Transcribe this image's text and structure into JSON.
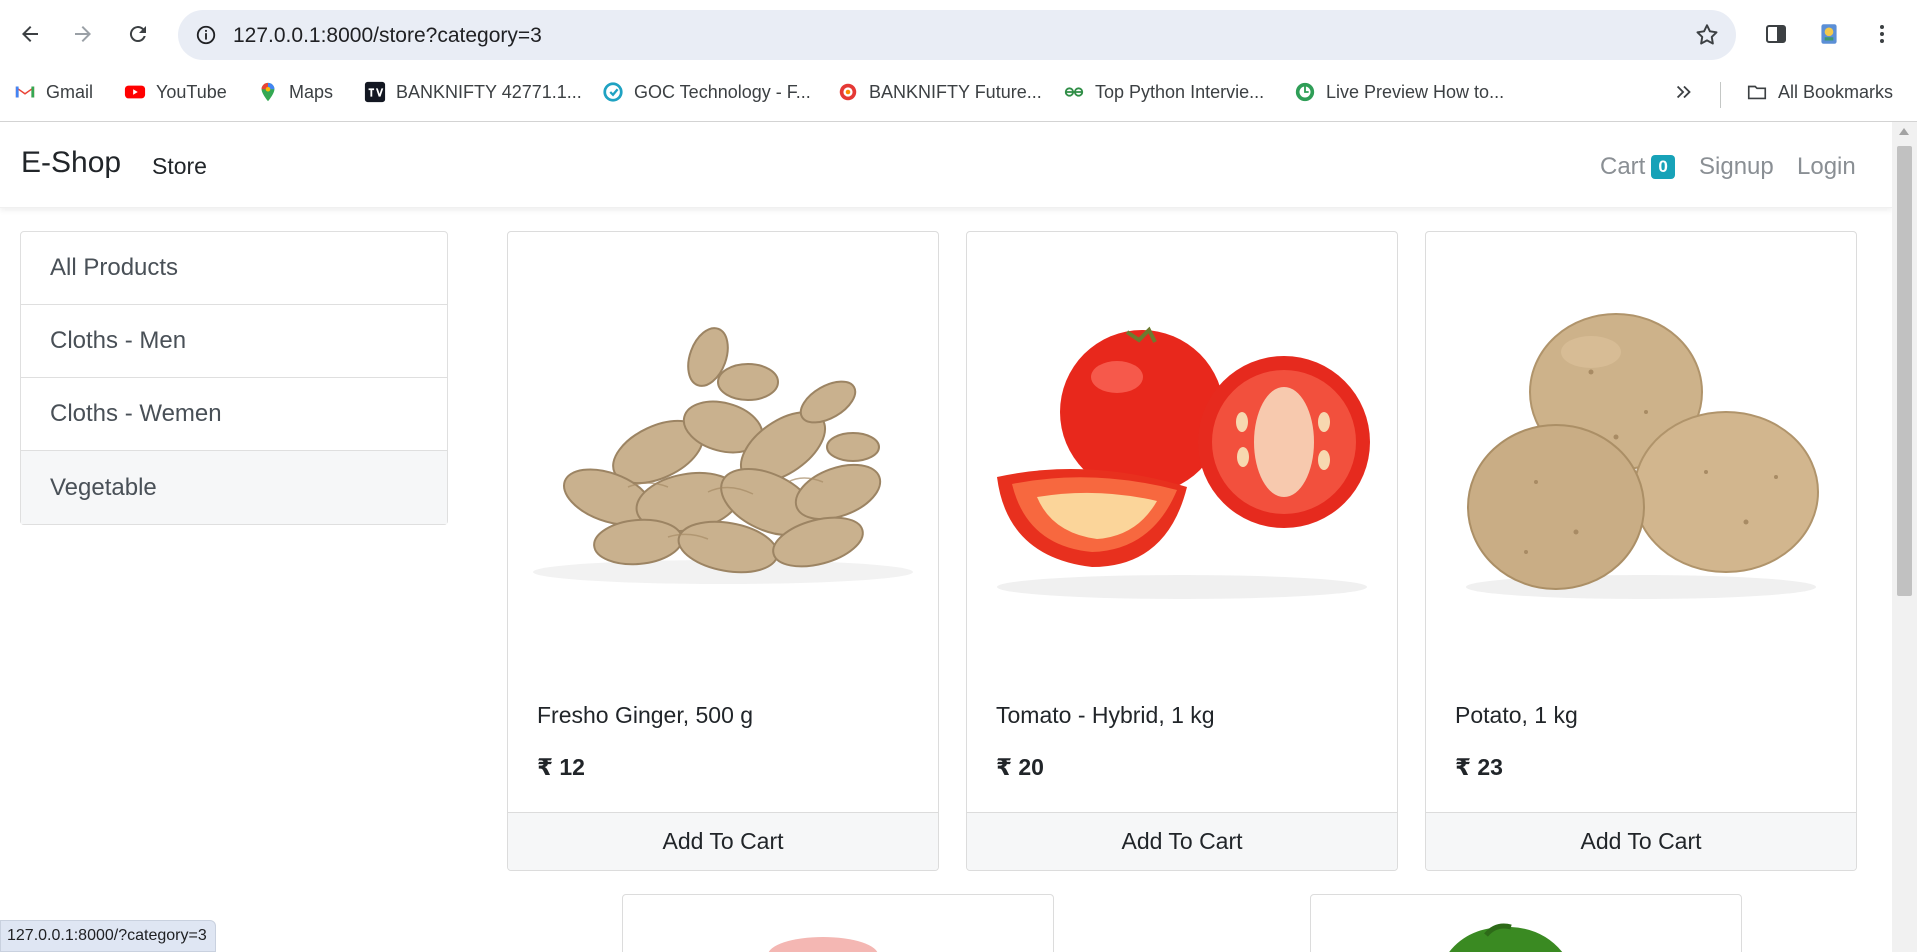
{
  "browser": {
    "url": "127.0.0.1:8000/store?category=3",
    "bookmarks": [
      {
        "label": "Gmail",
        "icon": "gmail-icon"
      },
      {
        "label": "YouTube",
        "icon": "youtube-icon"
      },
      {
        "label": "Maps",
        "icon": "maps-icon"
      },
      {
        "label": "BANKNIFTY 42771.1...",
        "icon": "tradingview-icon"
      },
      {
        "label": "GOC Technology - F...",
        "icon": "goc-icon"
      },
      {
        "label": "BANKNIFTY Future...",
        "icon": "banknifty-icon"
      },
      {
        "label": "Top Python Intervie...",
        "icon": "gfg-icon"
      },
      {
        "label": "Live Preview How to...",
        "icon": "livepreview-icon"
      }
    ],
    "all_bookmarks": "All Bookmarks",
    "status_url": "127.0.0.1:8000/?category=3"
  },
  "navbar": {
    "brand": "E-Shop",
    "store": "Store",
    "cart": "Cart",
    "cart_count": "0",
    "signup": "Signup",
    "login": "Login"
  },
  "categories": [
    {
      "label": "All Products",
      "active": false
    },
    {
      "label": "Cloths - Men",
      "active": false
    },
    {
      "label": "Cloths - Wemen",
      "active": false
    },
    {
      "label": "Vegetable",
      "active": true
    }
  ],
  "products": [
    {
      "name": "Fresho Ginger, 500 g",
      "price": "₹ 12",
      "button": "Add To Cart",
      "image": "ginger"
    },
    {
      "name": "Tomato - Hybrid, 1 kg",
      "price": "₹ 20",
      "button": "Add To Cart",
      "image": "tomato"
    },
    {
      "name": "Potato, 1 kg",
      "price": "₹ 23",
      "button": "Add To Cart",
      "image": "potato"
    }
  ],
  "colors": {
    "badge": "#17a2b8",
    "omnibox": "#e9edf5",
    "nav_muted": "#8a8f94"
  }
}
